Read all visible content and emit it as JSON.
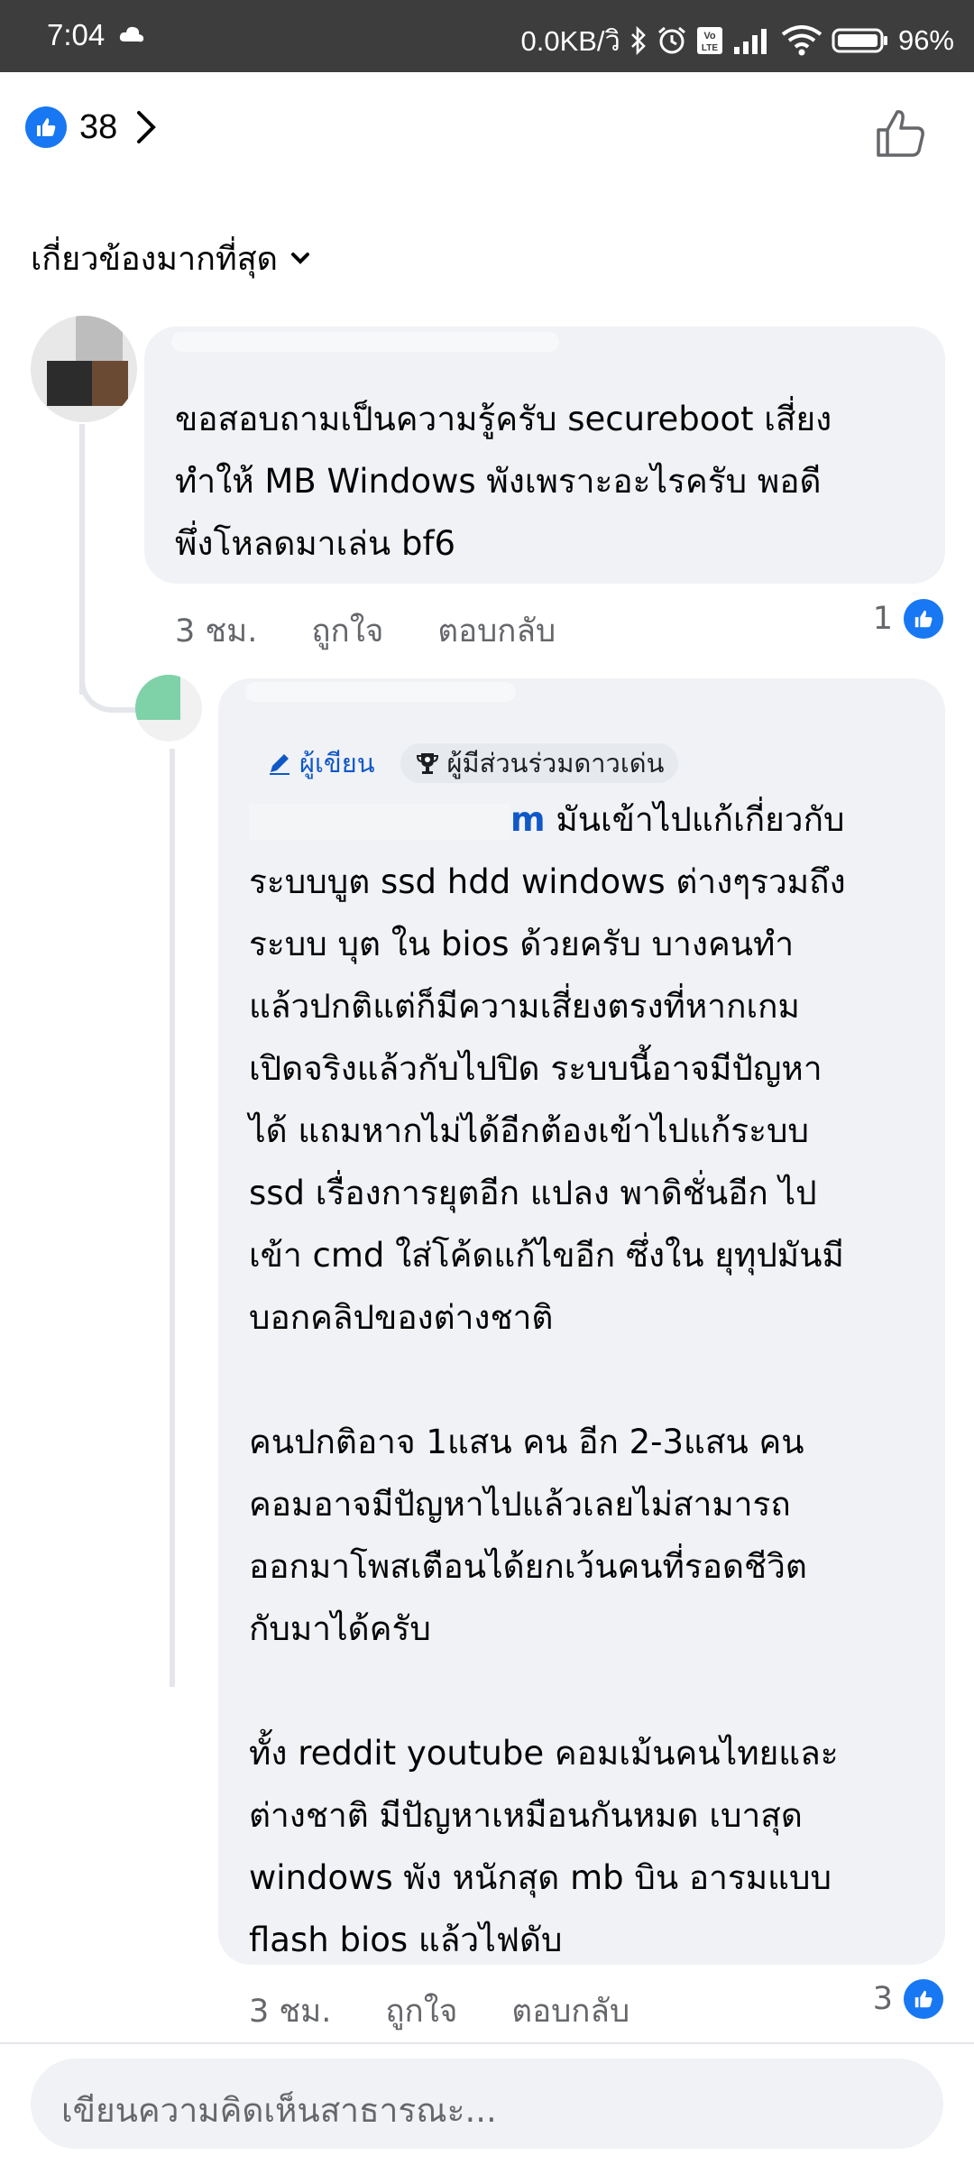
{
  "status_bar": {
    "time": "7:04",
    "network_speed": "0.0KB/วิ",
    "volte": "Vo LTE",
    "battery": "96%"
  },
  "header": {
    "like_count": "38",
    "sort_label": "เกี่ยวข้องมากที่สุด"
  },
  "comments": [
    {
      "text": "ขอสอบถามเป็นความรู้ครับ secureboot เสี่ยง\nทำให้ MB Windows พังเพราะอะไรครับ พอดี\nพึ่งโหลดมาเล่น bf6",
      "time": "3 ชม.",
      "like_label": "ถูกใจ",
      "reply_label": "ตอบกลับ",
      "reaction_count": "1"
    },
    {
      "badge_author": "ผู้เขียน",
      "badge_top_contributor": "ผู้มีส่วนร่วมดาวเด่น",
      "mention": "m",
      "text_first": " มันเข้าไปแก้เกี่ยวกับ",
      "text": "ระบบบูต ssd hdd windows ต่างๆรวมถึง\nระบบ บุต ใน bios ด้วยครับ  บางคนทำ\nแล้วปกติแต่ก็มีความเสี่ยงตรงที่หากเกม\nเปิดจริงแล้วกับไปปิด ระบบนี้อาจมีปัญหา\nได้  แถมหากไม่ได้อีกต้องเข้าไปแก้ระบบ\nssd เรื่องการยุตอีก แปลง พาดิชั่นอีก  ไป\nเข้า cmd ใส่โค้ดแก้ไขอีก ซึ่งใน ยุทุปมันมี\nบอกคลิปของต่างชาติ\n\nคนปกติอาจ 1แสน คน อีก 2-3แสน คน\nคอมอาจมีปัญหาไปแล้วเลยไม่สามารถ\nออกมาโพสเตือนได้ยกเว้นคนที่รอดชีวิต\nกับมาได้ครับ\n\nทั้ง reddit youtube คอมเม้นคนไทยและ\nต่างชาติ มีปัญหาเหมือนกันหมด   เบาสุด\nwindows พัง หนักสุด mb บิน อารมแบบ\nflash bios แล้วไฟดับ",
      "time": "3 ชม.",
      "like_label": "ถูกใจ",
      "reply_label": "ตอบกลับ",
      "reaction_count": "3"
    }
  ],
  "composer": {
    "placeholder": "เขียนความคิดเห็นสาธารณะ..."
  },
  "colors": {
    "accent": "#1877f2",
    "bubble": "#f0f2f5",
    "muted_text": "#65676b",
    "status_bar": "#3d3d3d"
  },
  "icons": [
    "cloud-icon",
    "bluetooth-icon",
    "alarm-icon",
    "signal-icon",
    "wifi-icon",
    "battery-icon",
    "like-icon",
    "chevron-right-icon",
    "thumbs-up-outline-icon",
    "chevron-down-icon",
    "pencil-icon",
    "trophy-icon"
  ]
}
